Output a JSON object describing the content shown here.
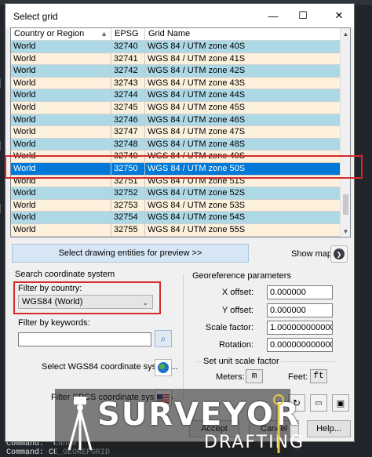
{
  "dialog": {
    "title": "Select grid",
    "controls": {
      "minimize": "—",
      "maximize": "☐",
      "close": "✕"
    }
  },
  "grid": {
    "columns": [
      "Country or Region",
      "EPSG",
      "Grid Name"
    ],
    "rows": [
      [
        "World",
        "32740",
        "WGS 84 / UTM zone 40S"
      ],
      [
        "World",
        "32741",
        "WGS 84 / UTM zone 41S"
      ],
      [
        "World",
        "32742",
        "WGS 84 / UTM zone 42S"
      ],
      [
        "World",
        "32743",
        "WGS 84 / UTM zone 43S"
      ],
      [
        "World",
        "32744",
        "WGS 84 / UTM zone 44S"
      ],
      [
        "World",
        "32745",
        "WGS 84 / UTM zone 45S"
      ],
      [
        "World",
        "32746",
        "WGS 84 / UTM zone 46S"
      ],
      [
        "World",
        "32747",
        "WGS 84 / UTM zone 47S"
      ],
      [
        "World",
        "32748",
        "WGS 84 / UTM zone 48S"
      ],
      [
        "World",
        "32749",
        "WGS 84 / UTM zone 49S"
      ],
      [
        "World",
        "32750",
        "WGS 84 / UTM zone 50S"
      ],
      [
        "World",
        "32751",
        "WGS 84 / UTM zone 51S"
      ],
      [
        "World",
        "32752",
        "WGS 84 / UTM zone 52S"
      ],
      [
        "World",
        "32753",
        "WGS 84 / UTM zone 53S"
      ],
      [
        "World",
        "32754",
        "WGS 84 / UTM zone 54S"
      ],
      [
        "World",
        "32755",
        "WGS 84 / UTM zone 55S"
      ]
    ],
    "selected_index": 10
  },
  "preview": {
    "button_label": "Select drawing entities for preview >>",
    "show_map_label": "Show map"
  },
  "search": {
    "group_title": "Search coordinate system",
    "filter_country_label": "Filter by country:",
    "filter_country_value": "WGS84 (World)",
    "filter_keywords_label": "Filter by keywords:",
    "keywords_value": "",
    "select_wgs84_label": "Select WGS84 coordinate system...",
    "filter_spcs_label": "Filter SPCS coordinate systems"
  },
  "georef": {
    "group_title": "Georeference parameters",
    "x_offset_label": "X offset:",
    "x_offset_value": "0.000000",
    "y_offset_label": "Y offset:",
    "y_offset_value": "0.000000",
    "scale_label": "Scale factor:",
    "scale_value": "1.000000000000",
    "rotation_label": "Rotation:",
    "rotation_value": "0.000000000000",
    "unit_scale_title": "Set unit scale factor",
    "meters_label": "Meters:",
    "meters_button": "m",
    "feet_label": "Feet:",
    "feet_button": "ft"
  },
  "footer": {
    "accept": "Accept",
    "cancel": "Cancel",
    "help": "Help..."
  },
  "command_line": {
    "line1": "Command: *Cancel*",
    "line2": "Command: CE_GEOREFGRID"
  },
  "watermark": {
    "line1": "SURVEYOR",
    "line2": "DRAFTING"
  },
  "colors": {
    "row_even": "#add8e6",
    "row_odd": "#fdf0dc",
    "selected": "#0078d7",
    "highlight_box": "#d42a2a"
  },
  "icons": [
    "sort-asc-icon",
    "arrow-right-icon",
    "search-icon",
    "globe-icon",
    "us-flag-icon",
    "refresh-icon",
    "open-folder-icon",
    "save-icon",
    "tripod-icon"
  ]
}
